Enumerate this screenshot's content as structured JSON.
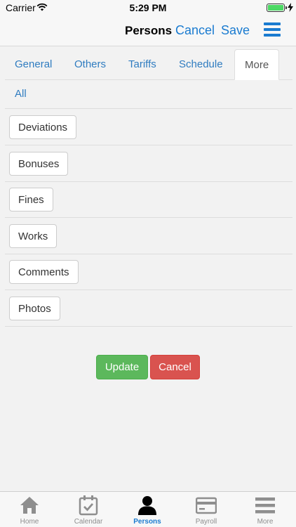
{
  "status_bar": {
    "carrier": "Carrier",
    "time": "5:29 PM"
  },
  "nav": {
    "title": "Persons",
    "cancel_label": "Cancel",
    "save_label": "Save",
    "menu_icon": "hamburger-icon"
  },
  "tabs": [
    {
      "label": "General",
      "active": false
    },
    {
      "label": "Others",
      "active": false
    },
    {
      "label": "Tariffs",
      "active": false
    },
    {
      "label": "Schedule",
      "active": false
    },
    {
      "label": "More",
      "active": true
    },
    {
      "label": "All",
      "active": false
    }
  ],
  "sections": [
    {
      "label": "Deviations"
    },
    {
      "label": "Bonuses"
    },
    {
      "label": "Fines"
    },
    {
      "label": "Works"
    },
    {
      "label": "Comments"
    },
    {
      "label": "Photos"
    }
  ],
  "actions": {
    "update_label": "Update",
    "cancel_label": "Cancel"
  },
  "tabbar": [
    {
      "label": "Home",
      "icon": "home-icon",
      "active": false
    },
    {
      "label": "Calendar",
      "icon": "calendar-icon",
      "active": false
    },
    {
      "label": "Persons",
      "icon": "person-icon",
      "active": true
    },
    {
      "label": "Payroll",
      "icon": "credit-card-icon",
      "active": false
    },
    {
      "label": "More",
      "icon": "menu-icon",
      "active": false
    }
  ],
  "colors": {
    "accent": "#1a7bd0",
    "link": "#2f7cc0",
    "success": "#5cb85c",
    "danger": "#d9534f",
    "inactive": "#8e8e8e"
  }
}
